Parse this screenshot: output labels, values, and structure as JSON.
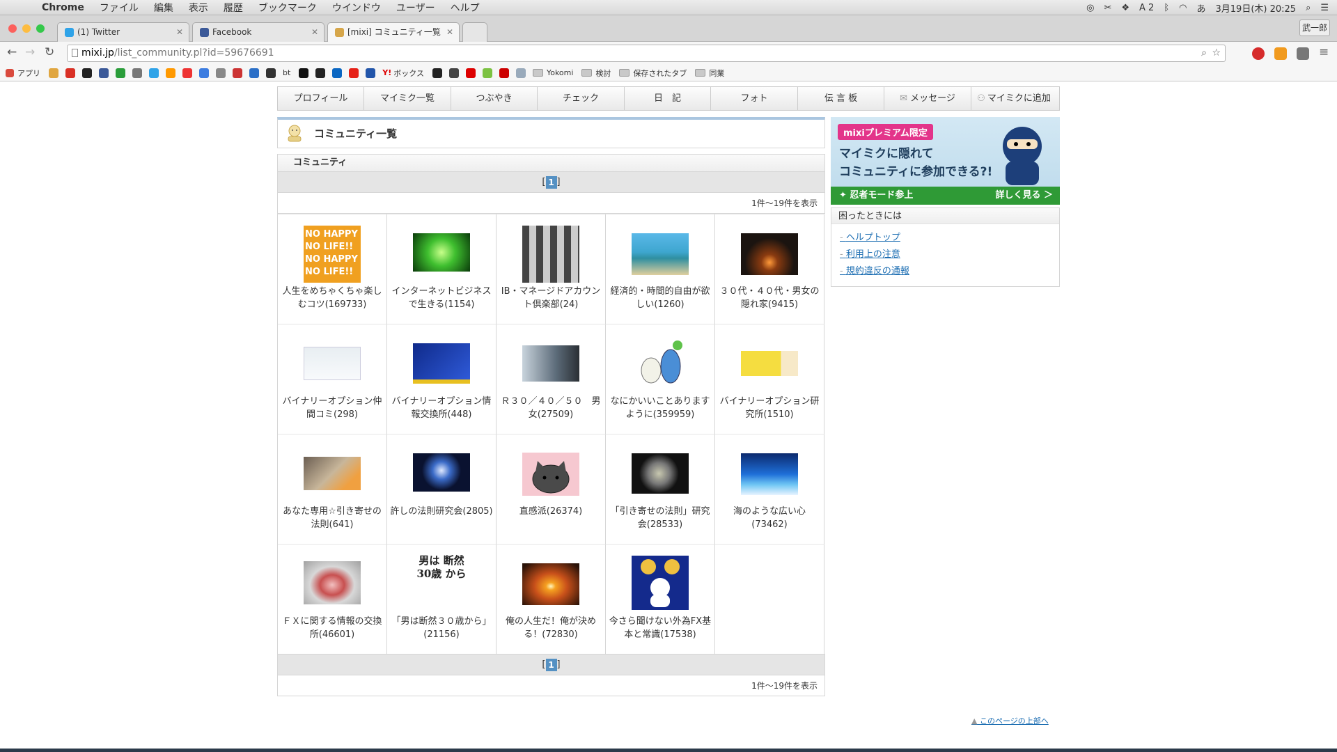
{
  "menubar": {
    "app": "Chrome",
    "items": [
      "ファイル",
      "編集",
      "表示",
      "履歴",
      "ブックマーク",
      "ウインドウ",
      "ユーザー",
      "ヘルプ"
    ],
    "status_a2": "A 2",
    "datetime": "3月19日(木)  20:25"
  },
  "tabs": [
    {
      "title": "(1) Twitter",
      "color": "#2fa3e8"
    },
    {
      "title": "Facebook",
      "color": "#3b5998"
    },
    {
      "title": "[mixi] コミュニティ一覧",
      "color": "#d6a64a"
    }
  ],
  "profile_name": "武一郎",
  "url": {
    "host": "mixi.jp",
    "path": "/list_community.pl?id=59676691"
  },
  "bookmarks": {
    "apps": "アプリ",
    "bt": "bt",
    "box": "ボックス",
    "yokomi": "Yokomi",
    "kento": "検討",
    "saved_tabs": "保存されたタブ",
    "dougyo": "同業"
  },
  "nav": [
    "プロフィール",
    "マイミク一覧",
    "つぶやき",
    "チェック",
    "日　記",
    "フォト",
    "伝 言 板",
    "メッセージ",
    "マイミクに追加"
  ],
  "page_title": "コミュニティ一覧",
  "section_header": "コミュニティ",
  "pager": {
    "current": "1",
    "count_text": "1件〜19件を表示"
  },
  "communities": [
    {
      "name": "人生をめちゃくちゃ楽しむコツ(169733)",
      "color": "#f0a020"
    },
    {
      "name": "インターネットビジネスで生きる(1154)",
      "color": "#3fbf2f"
    },
    {
      "name": "IB・マネージドアカウント倶楽部(24)",
      "color": "#6d6b6b"
    },
    {
      "name": "経済的・時間的自由が欲しい(1260)",
      "color": "#3ea6cf"
    },
    {
      "name": "３０代・４０代・男女の隠れ家(9415)",
      "color": "#1b1410"
    },
    {
      "name": "バイナリーオプション仲間コミ(298)",
      "color": "#e8eef2"
    },
    {
      "name": "バイナリーオプション情報交換所(448)",
      "color": "#0f2a8a"
    },
    {
      "name": "Ｒ３０／４０／５０　男女(27509)",
      "color": "#8a9aa8"
    },
    {
      "name": "なにかいいことありますように(359959)",
      "color": "#ffffff"
    },
    {
      "name": "バイナリーオプション研究所(1510)",
      "color": "#f5dd40"
    },
    {
      "name": "あなた専用☆引き寄せの法則(641)",
      "color": "#a0907a"
    },
    {
      "name": "許しの法則研究会(2805)",
      "color": "#1a3d78"
    },
    {
      "name": "直感派(26374)",
      "color": "#f6c8d0"
    },
    {
      "name": "「引き寄せの法則」研究会(28533)",
      "color": "#222222"
    },
    {
      "name": "海のような広い心(73462)",
      "color": "#1e6fd8"
    },
    {
      "name": "ＦＸに関する情報の交換所(46601)",
      "color": "#c85050"
    },
    {
      "name": "「男は断然３０歳から」(21156)",
      "color": "#ffffff"
    },
    {
      "name": "俺の人生だ！俺が決める！(72830)",
      "color": "#e67420"
    },
    {
      "name": "今さら聞けない外為FX基本と常識(17538)",
      "color": "#142a8c"
    }
  ],
  "thumb_texts": {
    "nohappy": "NO HAPPY NO LIFE!!",
    "man30": "男は 断然 30歳 から"
  },
  "banner": {
    "tag": "mixiプレミアム限定",
    "line1": "マイミクに隠れて",
    "line2": "コミュニティに参加できる?!",
    "bottom_left": "忍者モード参上",
    "bottom_right": "詳しく見る ＞"
  },
  "help": {
    "title": "困ったときには",
    "links": [
      "ヘルプトップ",
      "利用上の注意",
      "規約違反の通報"
    ]
  },
  "page_top": "このページの上部へ"
}
